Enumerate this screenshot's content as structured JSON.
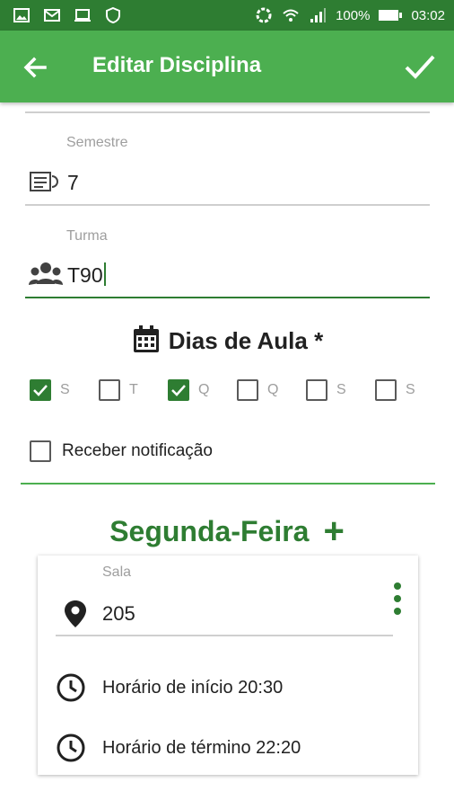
{
  "status_bar": {
    "battery": "100%",
    "time": "03:02"
  },
  "app_bar": {
    "title": "Editar Disciplina",
    "icons": [
      "back-arrow-icon",
      "check-icon"
    ]
  },
  "form": {
    "semestre": {
      "label": "Semestre",
      "value": "7",
      "icon": "semester-icon"
    },
    "turma": {
      "label": "Turma",
      "value": "T90",
      "icon": "group-icon"
    }
  },
  "dias_de_aula": {
    "title": "Dias de Aula *",
    "days": [
      {
        "label": "S",
        "checked": true
      },
      {
        "label": "T",
        "checked": false
      },
      {
        "label": "Q",
        "checked": true
      },
      {
        "label": "Q",
        "checked": false
      },
      {
        "label": "S",
        "checked": false
      },
      {
        "label": "S",
        "checked": false
      }
    ],
    "notification": {
      "label": "Receber notificação",
      "checked": false
    }
  },
  "schedule": {
    "day_title": "Segunda-Feira",
    "add_label": "+",
    "sala": {
      "label": "Sala",
      "value": "205"
    },
    "start": {
      "label": "Horário de início 20:30"
    },
    "end": {
      "label": "Horário de término 22:20"
    }
  },
  "colors": {
    "primary": "#4caf50",
    "primary_dark": "#2e7d32"
  }
}
